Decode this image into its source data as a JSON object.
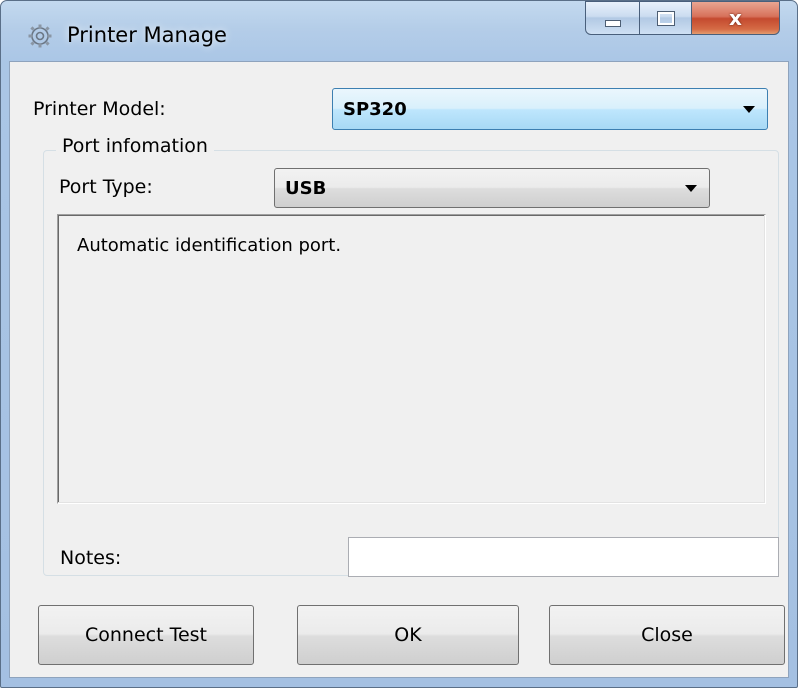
{
  "window": {
    "title": "Printer Manage",
    "icon": "gear-icon"
  },
  "caption_buttons": {
    "minimize": "minimize-icon",
    "maximize": "maximize-icon",
    "close": "x"
  },
  "printer_model": {
    "label": "Printer Model:",
    "value": "SP320"
  },
  "port_group": {
    "title": "Port infomation",
    "port_type_label": "Port Type:",
    "port_type_value": "USB",
    "info_text": "Automatic identification port."
  },
  "notes": {
    "label": "Notes:",
    "value": ""
  },
  "buttons": {
    "connect_test": "Connect Test",
    "ok": "OK",
    "close": "Close"
  },
  "colors": {
    "accent": "#3c7fb1",
    "close_button": "#c44a2f",
    "client_bg": "#f0f0f0"
  }
}
